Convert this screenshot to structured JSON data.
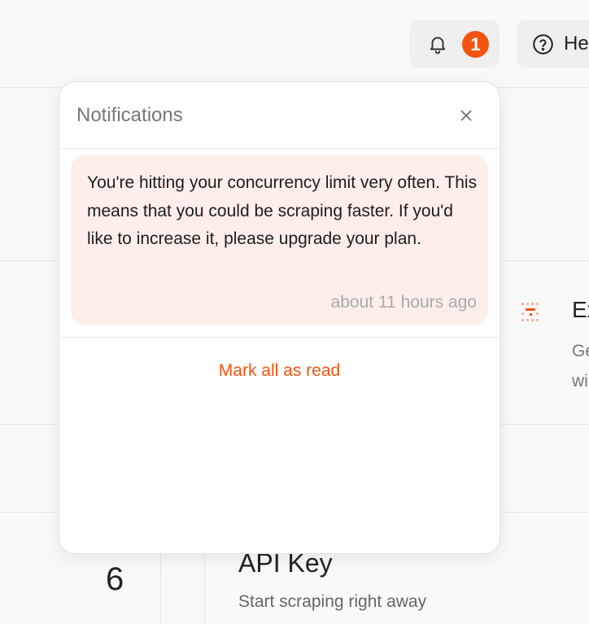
{
  "header": {
    "notification_count": "1",
    "help_label": "He"
  },
  "background": {
    "extension_title": "Ex",
    "extension_desc_line1": "Ge",
    "extension_desc_line2": "wi",
    "step_number": "6",
    "api_key_title": "API Key",
    "api_key_subtitle": "Start scraping right away"
  },
  "notifications": {
    "title": "Notifications",
    "items": [
      {
        "message": "You're hitting your concurrency limit very often. This means that you could be scraping faster. If you'd like to increase it, please upgrade your plan.",
        "time": "about 11 hours ago"
      }
    ],
    "mark_all_label": "Mark all as read"
  },
  "colors": {
    "accent": "#f2540f",
    "notification_bg": "#fdeee9"
  },
  "icons": [
    "bell-icon",
    "help-circle-icon",
    "close-icon",
    "extension-icon"
  ]
}
